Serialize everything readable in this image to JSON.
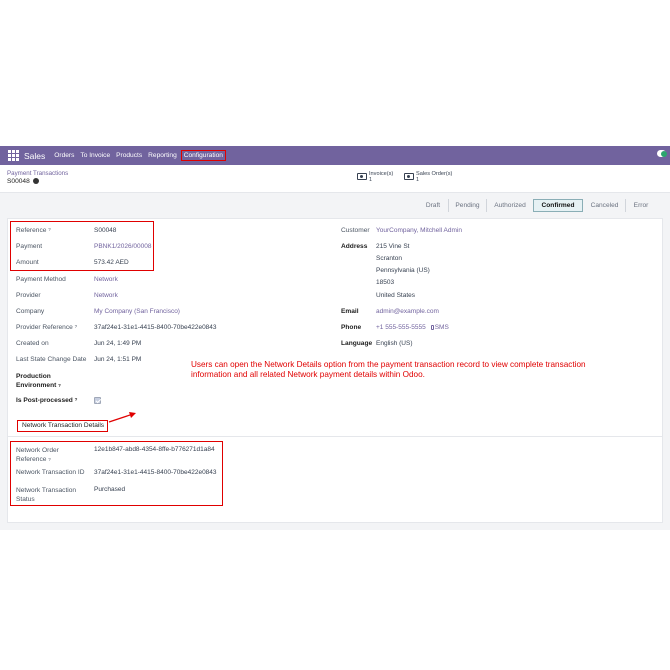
{
  "navbar": {
    "app_name": "Sales",
    "menu": [
      "Orders",
      "To Invoice",
      "Products",
      "Reporting",
      "Configuration"
    ],
    "color": "#71639e"
  },
  "control": {
    "breadcrumb": "Payment Transactions",
    "record": "S00048",
    "smart_buttons": [
      {
        "label": "Invoice(s)",
        "count": "1",
        "icon": "money-icon"
      },
      {
        "label": "Sales Order(s)",
        "count": "1",
        "icon": "money-icon"
      }
    ]
  },
  "statusbar": {
    "stages": [
      "Draft",
      "Pending",
      "Authorized",
      "Confirmed",
      "Canceled",
      "Error"
    ],
    "active": "Confirmed"
  },
  "left_fields": [
    {
      "label": "Reference",
      "tip": "?",
      "value": "S00048",
      "link": false
    },
    {
      "label": "Payment",
      "tip": "",
      "value": "PBNK1/2026/00008",
      "link": true
    },
    {
      "label": "Amount",
      "tip": "",
      "value": "573.42 AED",
      "link": false
    },
    {
      "label": "Payment Method",
      "tip": "",
      "value": "Network",
      "link": true
    },
    {
      "label": "Provider",
      "tip": "",
      "value": "Network",
      "link": true
    },
    {
      "label": "Company",
      "tip": "",
      "value": "My Company (San Francisco)",
      "link": true
    },
    {
      "label": "Provider Reference",
      "tip": "?",
      "value": "37af24e1-31e1-4415-8400-70be422e0843",
      "link": false
    },
    {
      "label": "Created on",
      "tip": "",
      "value": "Jun 24, 1:49 PM",
      "link": false
    },
    {
      "label": "Last State Change Date",
      "tip": "",
      "value": "Jun 24, 1:51 PM",
      "link": false
    }
  ],
  "production_environment": {
    "label_line1": "Production",
    "label_line2": "Environment",
    "tip": "?"
  },
  "is_post_processed": {
    "label": "Is Post-processed",
    "tip": "?",
    "checked": true
  },
  "right_fields": {
    "customer_label": "Customer",
    "customer_value": "YourCompany, Mitchell Admin",
    "address_label": "Address",
    "address_lines": [
      "215 Vine St",
      "Scranton",
      "Pennsylvania (US)",
      "18503",
      "United States"
    ],
    "email_label": "Email",
    "email_value": "admin@example.com",
    "phone_label": "Phone",
    "phone_value": "+1 555-555-5555",
    "sms_label": "SMS",
    "language_label": "Language",
    "language_value": "English (US)"
  },
  "annotation": "Users can open the Network Details option from the payment transaction record to view complete transaction information and all related Network payment details within Odoo.",
  "tab": {
    "label": "Network Transaction Details"
  },
  "network_fields": [
    {
      "label_line1": "Network Order",
      "label_line2": "Reference",
      "tip": "?",
      "value": "12e1b847-abd8-4354-8ffe-b776271d1a84"
    },
    {
      "label_line1": "Network Transaction ID",
      "label_line2": "",
      "tip": "",
      "value": "37af24e1-31e1-4415-8400-70be422e0843"
    },
    {
      "label_line1": "Network Transaction",
      "label_line2": "Status",
      "tip": "",
      "value": "Purchased"
    }
  ],
  "colors": {
    "accent": "#71639e",
    "highlight": "#e00000",
    "active_stage": "#e6f1f4"
  }
}
